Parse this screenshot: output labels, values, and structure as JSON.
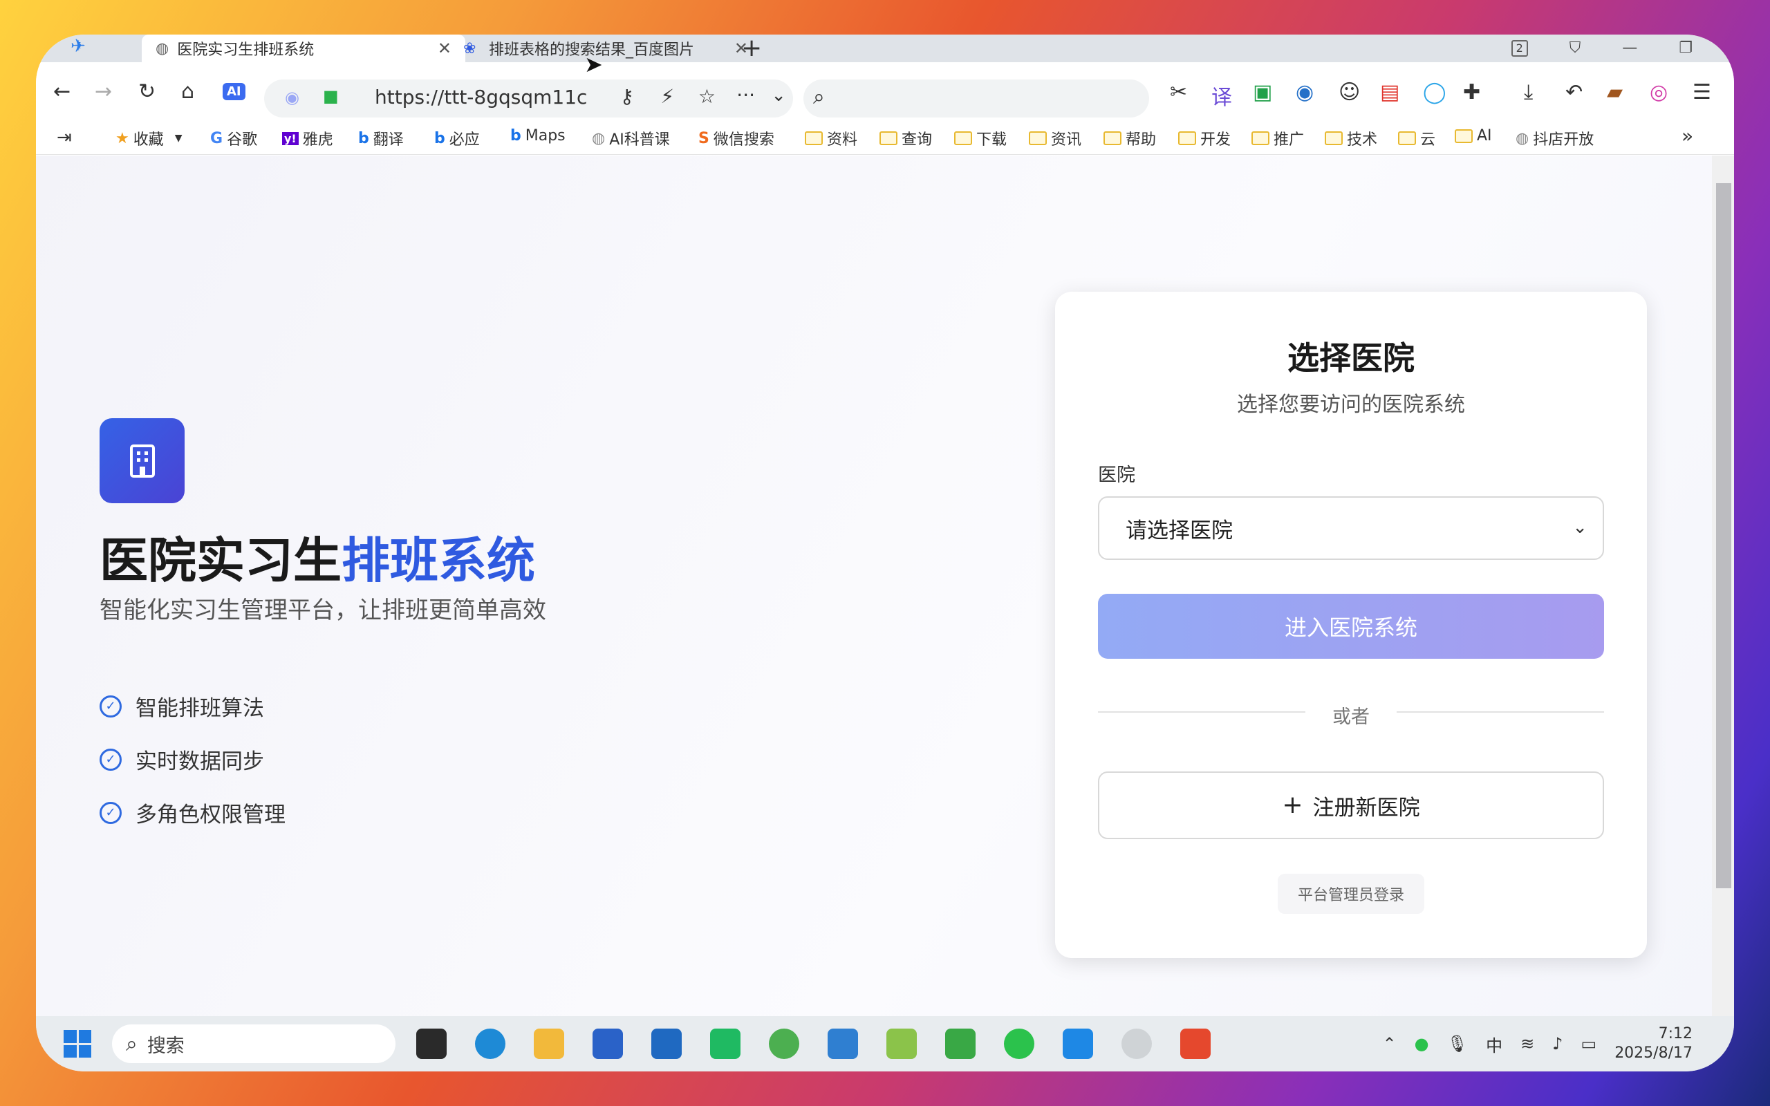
{
  "browser": {
    "tabs": [
      {
        "label": "医院实习生排班系统",
        "active": true
      },
      {
        "label": "排班表格的搜索结果_百度图片",
        "active": false
      }
    ],
    "tab_count_badge": "2",
    "url": "https://ttt-8gqsqm11c",
    "bookmarks": [
      {
        "label": "收藏",
        "icon": "star-icon"
      },
      {
        "label": "谷歌",
        "icon": "google-icon"
      },
      {
        "label": "雅虎",
        "icon": "yahoo-icon"
      },
      {
        "label": "翻译",
        "icon": "bing-icon"
      },
      {
        "label": "必应",
        "icon": "bing-icon"
      },
      {
        "label": "Maps",
        "icon": "bing-icon"
      },
      {
        "label": "AI科普课",
        "icon": "globe-icon"
      },
      {
        "label": "微信搜索",
        "icon": "sogou-icon"
      },
      {
        "label": "资料",
        "icon": "folder-icon"
      },
      {
        "label": "查询",
        "icon": "folder-icon"
      },
      {
        "label": "下载",
        "icon": "folder-icon"
      },
      {
        "label": "资讯",
        "icon": "folder-icon"
      },
      {
        "label": "帮助",
        "icon": "folder-icon"
      },
      {
        "label": "开发",
        "icon": "folder-icon"
      },
      {
        "label": "推广",
        "icon": "folder-icon"
      },
      {
        "label": "技术",
        "icon": "folder-icon"
      },
      {
        "label": "云",
        "icon": "folder-icon"
      },
      {
        "label": "AI",
        "icon": "folder-icon"
      },
      {
        "label": "抖店开放",
        "icon": "globe-icon"
      }
    ]
  },
  "hero": {
    "title_part1": "医院实习生",
    "title_part2": "排班系统",
    "subtitle": "智能化实习生管理平台，让排班更简单高效",
    "features": [
      "智能排班算法",
      "实时数据同步",
      "多角色权限管理"
    ]
  },
  "card": {
    "title": "选择医院",
    "subtitle": "选择您要访问的医院系统",
    "hospital_label": "医院",
    "hospital_select_value": "请选择医院",
    "enter_button": "进入医院系统",
    "divider_text": "或者",
    "register_button": "注册新医院",
    "admin_link": "平台管理员登录"
  },
  "taskbar": {
    "search_placeholder": "搜索",
    "ime": "中",
    "time": "7:12",
    "date": "2025/8/17"
  },
  "colors": {
    "accent": "#2f5ae0",
    "button_gradient_start": "#93aaf5",
    "button_gradient_end": "#a79bef"
  }
}
